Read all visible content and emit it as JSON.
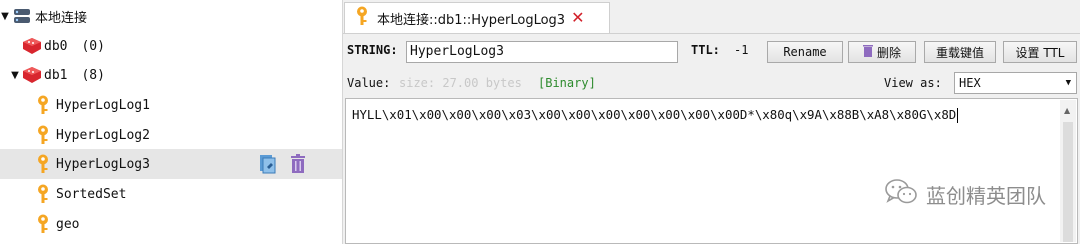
{
  "tree": {
    "connection": {
      "label": "本地连接",
      "icon": "server-icon",
      "arrow": "▼"
    },
    "databases": [
      {
        "label": "db0",
        "count": "(0)",
        "arrow": ""
      },
      {
        "label": "db1",
        "count": "(8)",
        "arrow": "▼"
      }
    ],
    "keys": [
      {
        "label": "HyperLogLog1"
      },
      {
        "label": "HyperLogLog2"
      },
      {
        "label": "HyperLogLog3",
        "selected": true
      },
      {
        "label": "SortedSet"
      },
      {
        "label": "geo"
      }
    ]
  },
  "tab": {
    "title": "本地连接::db1::HyperLogLog3",
    "close": "✕"
  },
  "keybar": {
    "type_label": "STRING:",
    "key_value": "HyperLogLog3",
    "ttl_label": "TTL:",
    "ttl_value": "-1",
    "rename": "Rename",
    "delete": "删除",
    "reload": "重载键值",
    "set_ttl": "设置 TTL"
  },
  "valuebar": {
    "value_label": "Value:",
    "size": "size: 27.00 bytes",
    "binary": "[Binary]",
    "view_as_label": "View as:",
    "view_as_value": "HEX"
  },
  "value_text": "HYLL\\x01\\x00\\x00\\x00\\x03\\x00\\x00\\x00\\x00\\x00\\x00\\x00D*\\x80q\\x9A\\x88B\\xA8\\x80G\\x8D",
  "watermark": "蓝创精英团队",
  "colors": {
    "accent_key": "#f5a623",
    "db_red": "#d8262e",
    "close_red": "#d2202a",
    "binary_green": "#2e8b2e",
    "delete_purple": "#8e6bbf",
    "selected_row": "#e6e6e6"
  }
}
